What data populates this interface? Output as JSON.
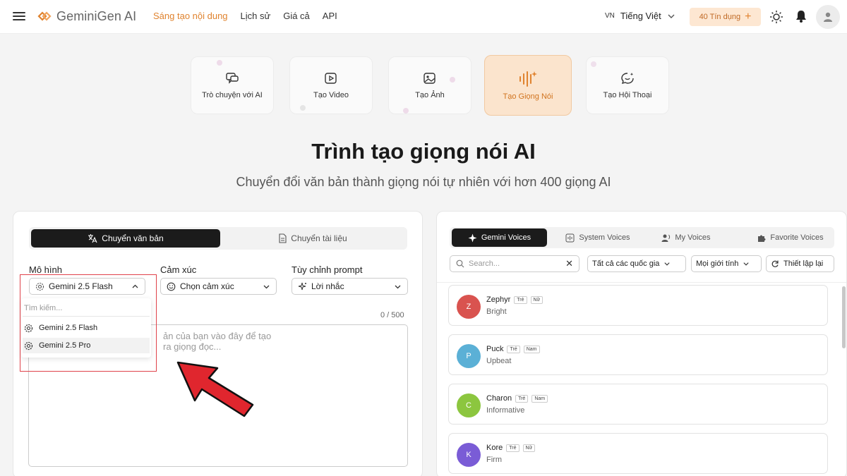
{
  "header": {
    "logo_text": "GeminiGen AI",
    "nav": [
      "Sáng tạo nội dung",
      "Lịch sử",
      "Giá cả",
      "API"
    ],
    "lang_code": "VN",
    "lang_label": "Tiếng Việt",
    "credits": "40 Tín dụng"
  },
  "tools": [
    {
      "label": "Trò chuyện với AI",
      "icon": "chat-icon"
    },
    {
      "label": "Tạo Video",
      "icon": "video-icon"
    },
    {
      "label": "Tạo Ảnh",
      "icon": "image-icon"
    },
    {
      "label": "Tạo Giọng Nói",
      "icon": "voice-wave-icon"
    },
    {
      "label": "Tạo Hội Thoại",
      "icon": "dialog-icon"
    }
  ],
  "title": "Trình tạo giọng nói AI",
  "subtitle": "Chuyển đổi văn bản thành giọng nói tự nhiên với hơn 400 giọng AI",
  "left": {
    "mode_text": "Chuyển văn bản",
    "mode_doc": "Chuyển tài liệu",
    "model_label": "Mô hình",
    "model_value": "Gemini 2.5 Flash",
    "emotion_label": "Cảm xúc",
    "emotion_value": "Chọn cảm xúc",
    "prompt_label": "Tùy chỉnh prompt",
    "prompt_value": "Lời nhắc",
    "counter": "0 / 500",
    "textarea_placeholder": "ản của bạn vào đây để tạo ra giọng đọc...",
    "dropdown_search": "Tìm kiếm...",
    "dropdown_options": [
      "Gemini 2.5 Flash",
      "Gemini 2.5 Pro"
    ]
  },
  "right": {
    "tabs": [
      "Gemini Voices",
      "System Voices",
      "My Voices",
      "Favorite Voices"
    ],
    "search_placeholder": "Search...",
    "filter_country": "Tất cả các quốc gia",
    "filter_gender": "Mọi giới tính",
    "reset": "Thiết lập lại",
    "voices": [
      {
        "initial": "Z",
        "name": "Zephyr",
        "age": "Trẻ",
        "gender": "Nữ",
        "desc": "Bright",
        "color": "#d9534f"
      },
      {
        "initial": "P",
        "name": "Puck",
        "age": "Trẻ",
        "gender": "Nam",
        "desc": "Upbeat",
        "color": "#5bb0d6"
      },
      {
        "initial": "C",
        "name": "Charon",
        "age": "Trẻ",
        "gender": "Nam",
        "desc": "Informative",
        "color": "#8cc63f"
      },
      {
        "initial": "K",
        "name": "Kore",
        "age": "Trẻ",
        "gender": "Nữ",
        "desc": "Firm",
        "color": "#7a5cd6"
      }
    ]
  },
  "colors": {
    "accent": "#e0832f",
    "active_dark": "#1b1b1b",
    "annotation_red": "#e0424a"
  }
}
